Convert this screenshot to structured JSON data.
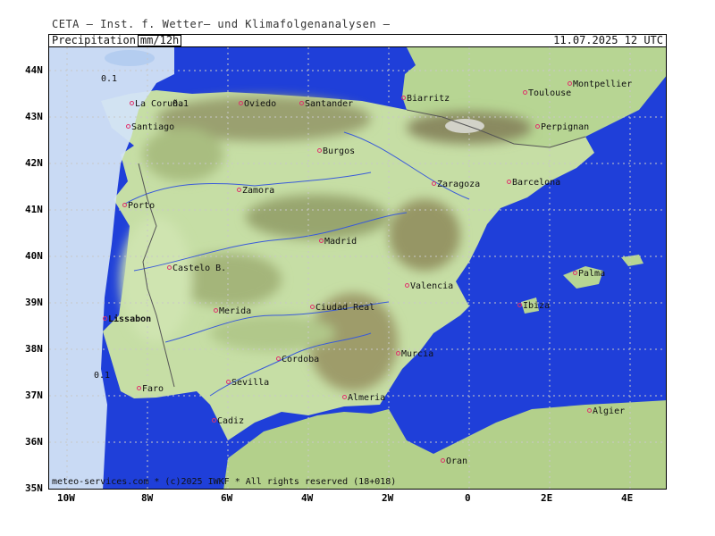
{
  "header": {
    "model": "CETA — Inst. f. Wetter— und Klimafolgenanalysen —"
  },
  "bar": {
    "title": "Precipitation",
    "unit": "mm/12h",
    "time": "11.07.2025 12 UTC"
  },
  "footer": {
    "credit": "meteo-services.com * (c)2025 IWKF * All rights reserved (18+018)"
  },
  "colors": {
    "sea": "#1f3fd9",
    "land_low": "#c9e2a8",
    "land_mid": "#a8c883",
    "land_high": "#8e8e60",
    "peak": "#c9c9c0",
    "precip": "#d3e3f5"
  },
  "lat_labels": [
    "44N",
    "43N",
    "42N",
    "41N",
    "40N",
    "39N",
    "38N",
    "37N",
    "36N",
    "35N"
  ],
  "lon_labels": [
    "10W",
    "8W",
    "6W",
    "4W",
    "2W",
    "0",
    "2E",
    "4E"
  ],
  "precip_labels": [
    "0.1",
    "0.1",
    "0.1"
  ],
  "cities": [
    {
      "name": "La Coruña"
    },
    {
      "name": "Oviedo"
    },
    {
      "name": "Santander"
    },
    {
      "name": "Biarritz"
    },
    {
      "name": "Toulouse"
    },
    {
      "name": "Montpellier"
    },
    {
      "name": "Santiago"
    },
    {
      "name": "Perpignan"
    },
    {
      "name": "Burgos"
    },
    {
      "name": "Zaragoza"
    },
    {
      "name": "Barcelona"
    },
    {
      "name": "Zamora"
    },
    {
      "name": "Porto"
    },
    {
      "name": "Madrid"
    },
    {
      "name": "Castelo B."
    },
    {
      "name": "Palma"
    },
    {
      "name": "Valencia"
    },
    {
      "name": "Merida"
    },
    {
      "name": "Ciudad Real"
    },
    {
      "name": "Ibiza"
    },
    {
      "name": "Lissabon"
    },
    {
      "name": "Murcia"
    },
    {
      "name": "Cordoba"
    },
    {
      "name": "Sevilla"
    },
    {
      "name": "Faro"
    },
    {
      "name": "Almeria"
    },
    {
      "name": "Algier"
    },
    {
      "name": "Cadiz"
    },
    {
      "name": "Oran"
    }
  ]
}
